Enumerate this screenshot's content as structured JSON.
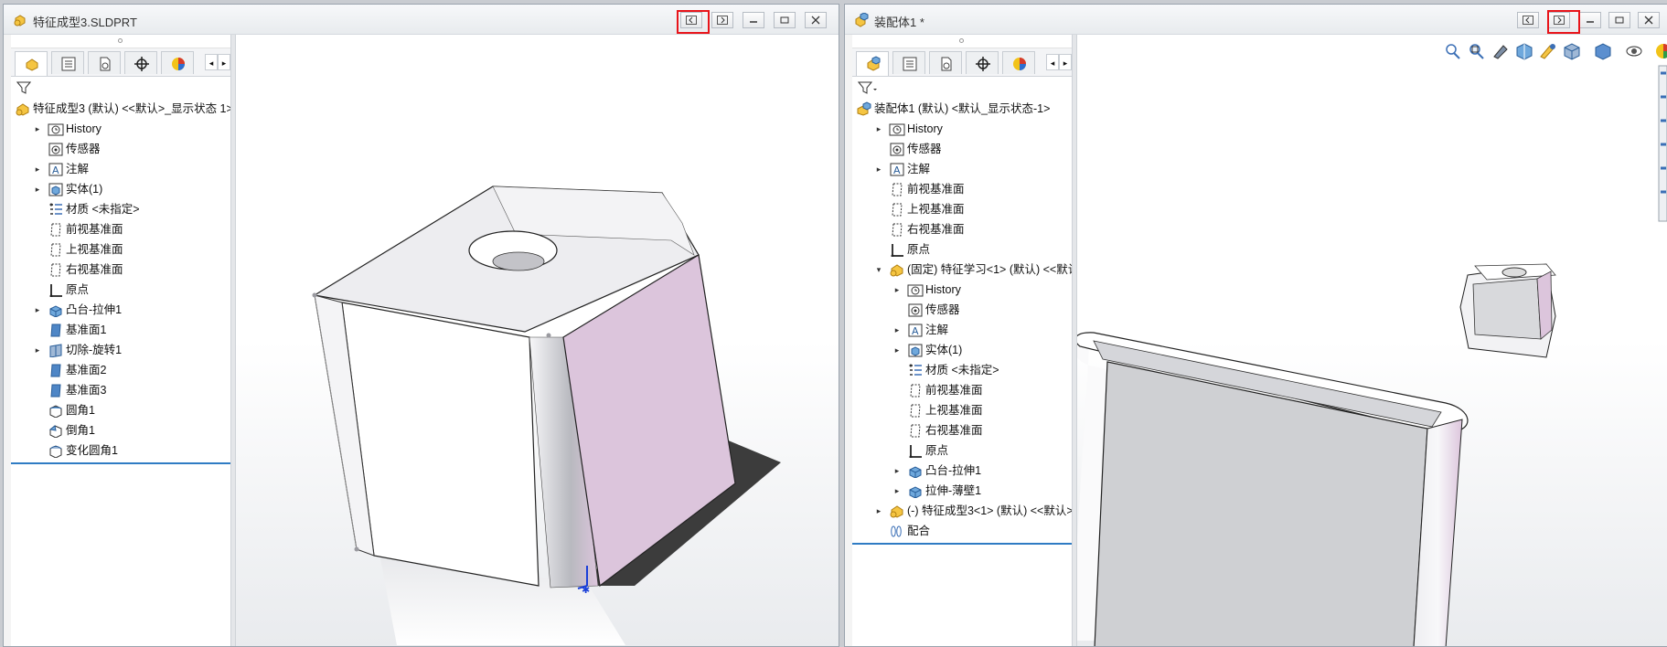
{
  "left_window": {
    "title": "特征成型3.SLDPRT",
    "tree": [
      {
        "label": "特征成型3 (默认) <<默认>_显示状态 1>",
        "icon": "part-icon",
        "expand": "",
        "indent": 0
      },
      {
        "label": "History",
        "icon": "history-folder-icon",
        "expand": "▸",
        "indent": 1
      },
      {
        "label": "传感器",
        "icon": "sensor-icon",
        "expand": "",
        "indent": 1
      },
      {
        "label": "注解",
        "icon": "annotation-icon",
        "expand": "▸",
        "indent": 1
      },
      {
        "label": "实体(1)",
        "icon": "solid-bodies-icon",
        "expand": "▸",
        "indent": 1
      },
      {
        "label": "材质 <未指定>",
        "icon": "material-icon",
        "expand": "",
        "indent": 1
      },
      {
        "label": "前视基准面",
        "icon": "plane-icon",
        "expand": "",
        "indent": 1
      },
      {
        "label": "上视基准面",
        "icon": "plane-icon",
        "expand": "",
        "indent": 1
      },
      {
        "label": "右视基准面",
        "icon": "plane-icon",
        "expand": "",
        "indent": 1
      },
      {
        "label": "原点",
        "icon": "origin-icon",
        "expand": "",
        "indent": 1
      },
      {
        "label": "凸台-拉伸1",
        "icon": "extrude-icon",
        "expand": "▸",
        "indent": 1
      },
      {
        "label": "基准面1",
        "icon": "ref-plane-icon",
        "expand": "",
        "indent": 1
      },
      {
        "label": "切除-旋转1",
        "icon": "revolve-cut-icon",
        "expand": "▸",
        "indent": 1
      },
      {
        "label": "基准面2",
        "icon": "ref-plane-icon",
        "expand": "",
        "indent": 1
      },
      {
        "label": "基准面3",
        "icon": "ref-plane-icon",
        "expand": "",
        "indent": 1
      },
      {
        "label": "圆角1",
        "icon": "fillet-icon",
        "expand": "",
        "indent": 1
      },
      {
        "label": "倒角1",
        "icon": "chamfer-icon",
        "expand": "",
        "indent": 1
      },
      {
        "label": "变化圆角1",
        "icon": "variable-fillet-icon",
        "expand": "",
        "indent": 1
      }
    ]
  },
  "right_window": {
    "title": "装配体1 *",
    "tree": [
      {
        "label": "装配体1 (默认) <默认_显示状态-1>",
        "icon": "assembly-icon",
        "expand": "",
        "indent": 0
      },
      {
        "label": "History",
        "icon": "history-folder-icon",
        "expand": "▸",
        "indent": 1
      },
      {
        "label": "传感器",
        "icon": "sensor-icon",
        "expand": "",
        "indent": 1
      },
      {
        "label": "注解",
        "icon": "annotation-icon",
        "expand": "▸",
        "indent": 1
      },
      {
        "label": "前视基准面",
        "icon": "plane-icon",
        "expand": "",
        "indent": 1
      },
      {
        "label": "上视基准面",
        "icon": "plane-icon",
        "expand": "",
        "indent": 1
      },
      {
        "label": "右视基准面",
        "icon": "plane-icon",
        "expand": "",
        "indent": 1
      },
      {
        "label": "原点",
        "icon": "origin-icon",
        "expand": "",
        "indent": 1
      },
      {
        "label": "(固定) 特征学习<1> (默认) <<默认",
        "icon": "part-icon",
        "expand": "▾",
        "indent": 1
      },
      {
        "label": "History",
        "icon": "history-folder-icon",
        "expand": "▸",
        "indent": 2
      },
      {
        "label": "传感器",
        "icon": "sensor-icon",
        "expand": "",
        "indent": 2
      },
      {
        "label": "注解",
        "icon": "annotation-icon",
        "expand": "▸",
        "indent": 2
      },
      {
        "label": "实体(1)",
        "icon": "solid-bodies-icon",
        "expand": "▸",
        "indent": 2
      },
      {
        "label": "材质 <未指定>",
        "icon": "material-icon",
        "expand": "",
        "indent": 2
      },
      {
        "label": "前视基准面",
        "icon": "plane-icon",
        "expand": "",
        "indent": 2
      },
      {
        "label": "上视基准面",
        "icon": "plane-icon",
        "expand": "",
        "indent": 2
      },
      {
        "label": "右视基准面",
        "icon": "plane-icon",
        "expand": "",
        "indent": 2
      },
      {
        "label": "原点",
        "icon": "origin-icon",
        "expand": "",
        "indent": 2
      },
      {
        "label": "凸台-拉伸1",
        "icon": "extrude-icon",
        "expand": "▸",
        "indent": 2
      },
      {
        "label": "拉伸-薄壁1",
        "icon": "extrude-icon",
        "expand": "▸",
        "indent": 2
      },
      {
        "label": "(-) 特征成型3<1> (默认) <<默认>_",
        "icon": "part-icon",
        "expand": "▸",
        "indent": 1
      },
      {
        "label": "配合",
        "icon": "mates-icon",
        "expand": "",
        "indent": 1
      }
    ]
  },
  "colors": {
    "highlight_box": "#e8141a",
    "tree_end_line": "#2f7cc4",
    "model_face_pink": "#dcc5dc",
    "model_face_white": "#ffffff"
  }
}
